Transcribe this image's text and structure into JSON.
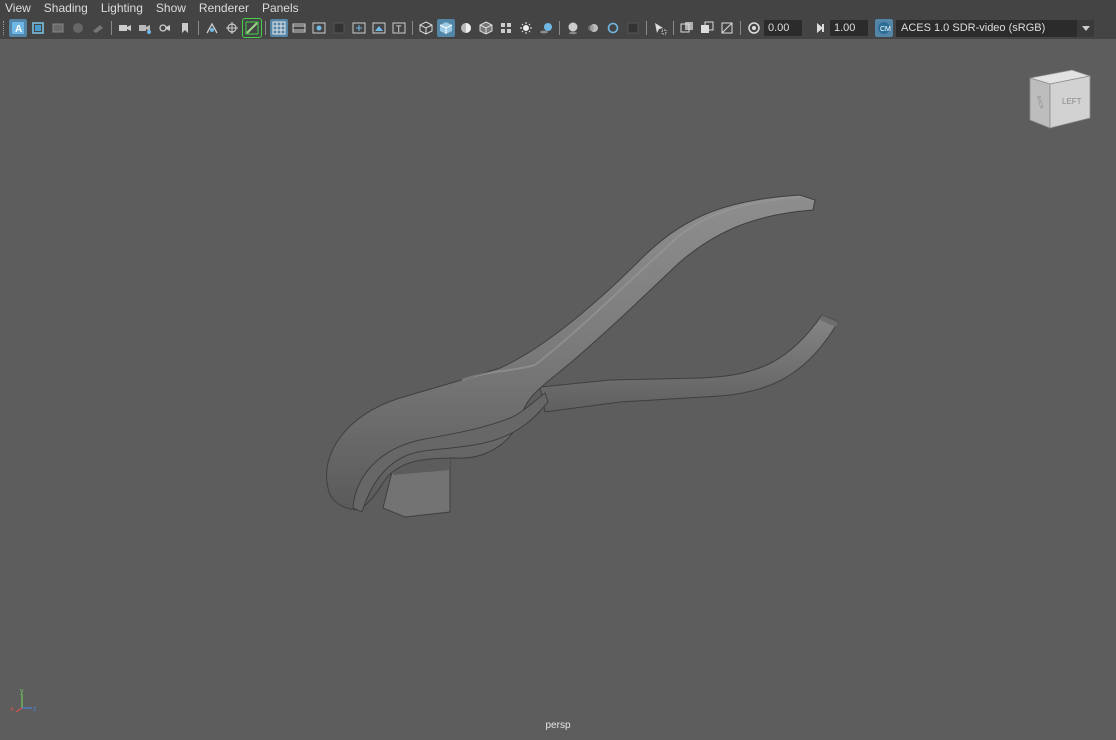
{
  "menu": [
    "View",
    "Shading",
    "Lighting",
    "Show",
    "Renderer",
    "Panels"
  ],
  "toolbar": {
    "exposure": "0.00",
    "gamma": "1.00",
    "color_space": "ACES 1.0 SDR-video (sRGB)"
  },
  "viewcube": {
    "left_face": "LEFT",
    "front_face": "BACK"
  },
  "axis": {
    "x": "x",
    "y": "y",
    "z": "z"
  },
  "camera_label": "persp",
  "colors": {
    "background": "#5d5d5d",
    "toolbar_bg": "#444444",
    "active_button": "#5285a6",
    "selected_outline": "#48d04a"
  }
}
